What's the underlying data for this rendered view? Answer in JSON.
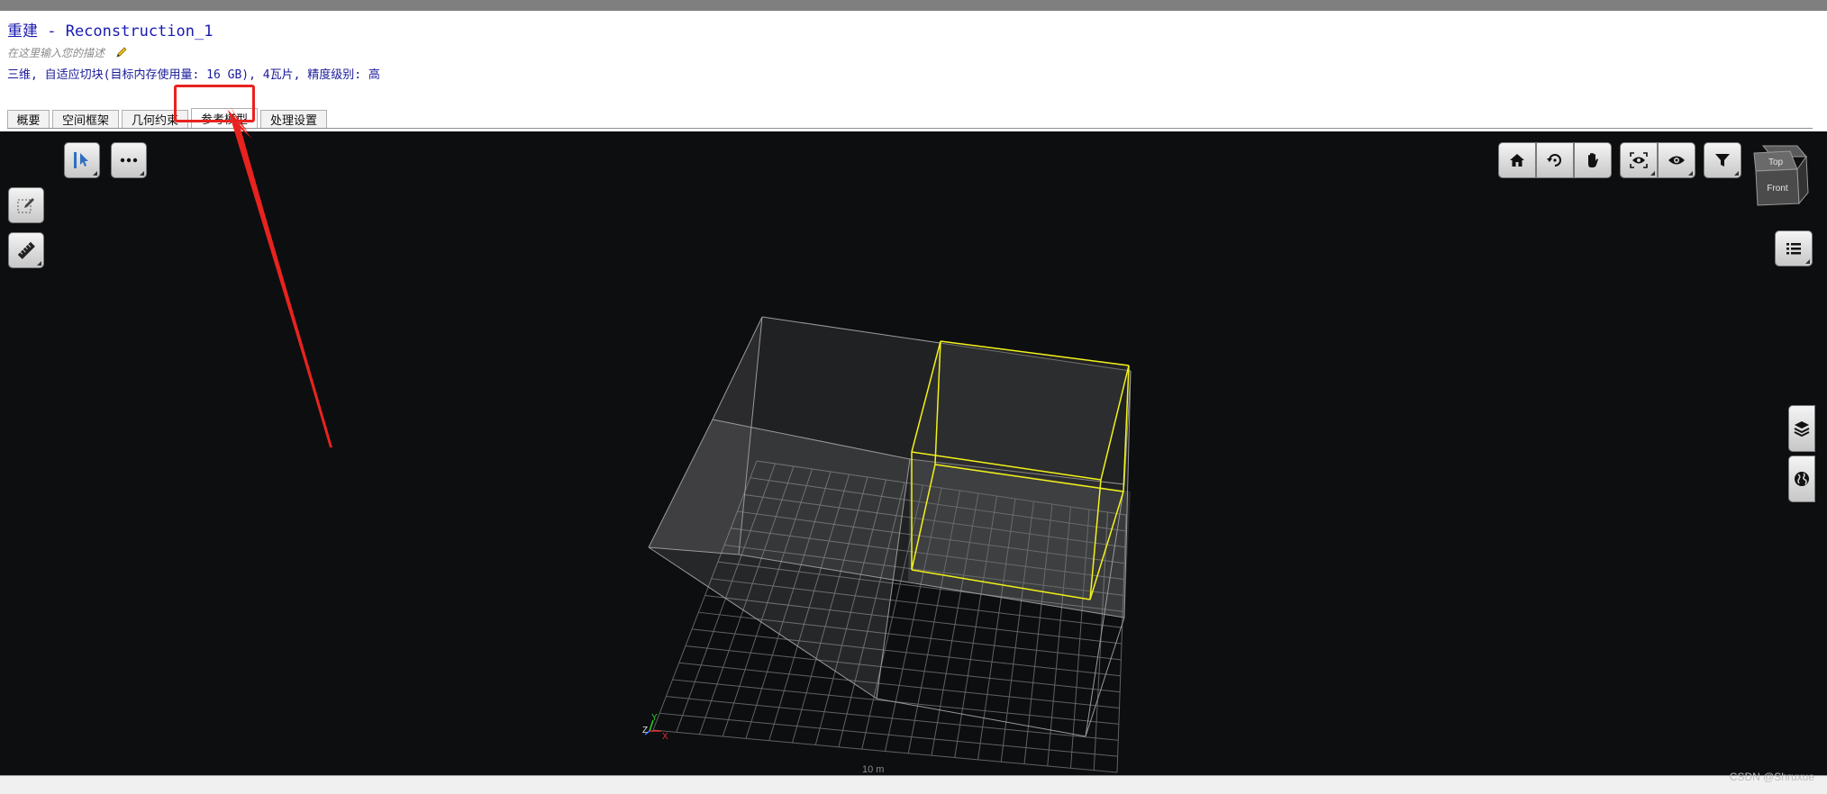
{
  "window": {
    "title": "重建 - Reconstruction_1",
    "description_placeholder": "在这里输入您的描述",
    "summary": "三维, 自适应切块(目标内存使用量: 16 GB), 4瓦片, 精度级别: 高"
  },
  "tabs": [
    {
      "label": "概要"
    },
    {
      "label": "空间框架"
    },
    {
      "label": "几何约束"
    },
    {
      "label": "参考模型",
      "active": true
    },
    {
      "label": "处理设置"
    }
  ],
  "viewport": {
    "navcube": {
      "top": "Top",
      "front": "Front"
    },
    "scale_label": "10 m",
    "axes": {
      "x": "X",
      "y": "Y",
      "z": "Z"
    }
  },
  "icons": {
    "select": "cursor-select-icon",
    "more": "more-dots-icon",
    "edit": "pencil-icon",
    "measure": "ruler-icon",
    "home": "home-icon",
    "orbit": "orbit-icon",
    "pan": "hand-pan-icon",
    "focus": "focus-eye-icon",
    "visibility": "eye-icon",
    "filter": "filter-icon",
    "list": "list-icon",
    "layers": "layers-icon",
    "globe": "globe-icon"
  },
  "colors": {
    "accent_annotation": "#e8231f",
    "selection_box": "#f2f21a",
    "title_text": "#1a1ab0"
  },
  "footer": {
    "watermark": "CSDN @Shruxue"
  }
}
